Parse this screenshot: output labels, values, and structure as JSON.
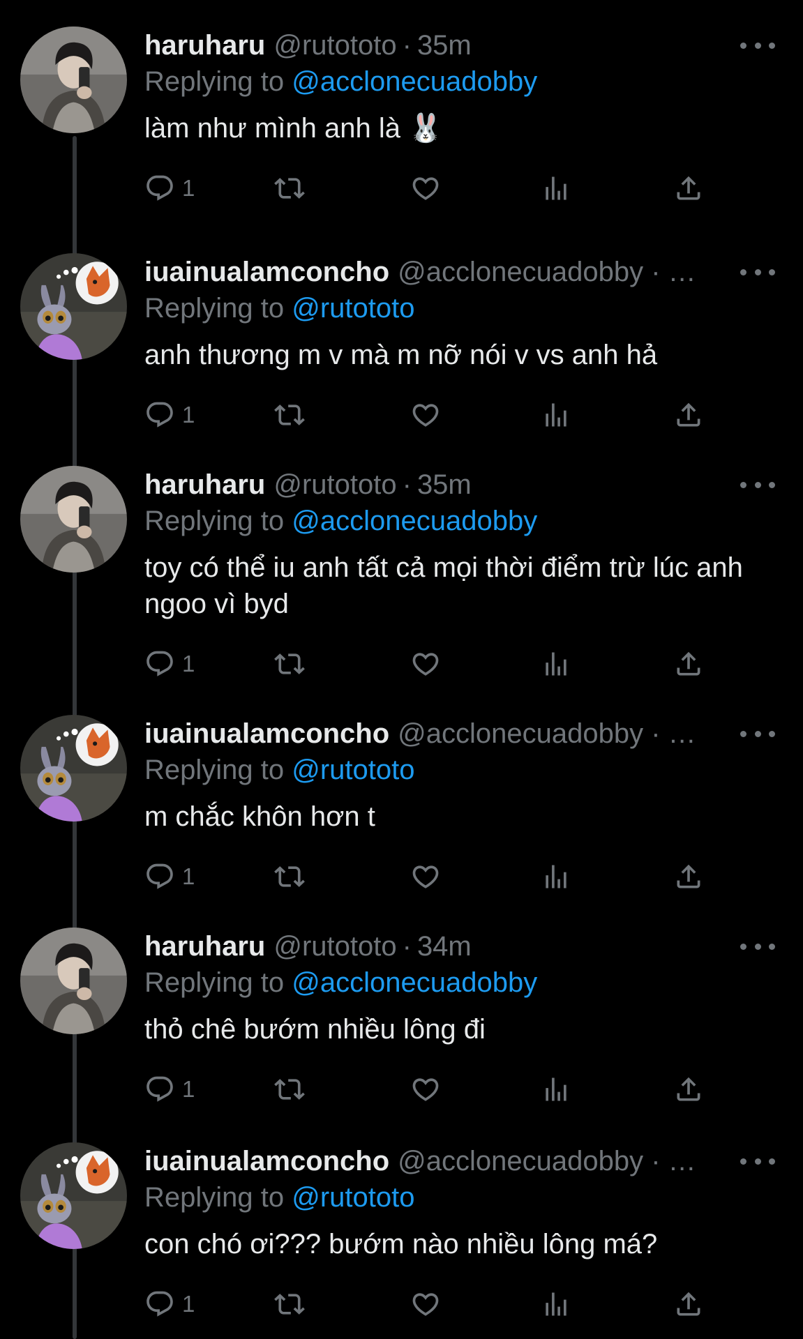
{
  "tweets": [
    {
      "avatar": "avatar-photo-selfie",
      "name": "haruharu",
      "handle": "@rutototo",
      "time": "35m",
      "reply_prefix": "Replying to",
      "reply_to": "@acclonecuadobby",
      "text": "làm như mình anh là 🐰",
      "reply_count": "1"
    },
    {
      "avatar": "avatar-cartoon-bunny-fox",
      "name": "iuainualamconcho",
      "handle": "@acclonecuadobby",
      "time": "",
      "reply_prefix": "Replying to",
      "reply_to": "@rutototo",
      "text": "anh thương m v mà m nỡ nói v vs anh hả",
      "reply_count": "1"
    },
    {
      "avatar": "avatar-photo-selfie",
      "name": "haruharu",
      "handle": "@rutototo",
      "time": "35m",
      "reply_prefix": "Replying to",
      "reply_to": "@acclonecuadobby",
      "text": "toy có thể iu anh tất cả mọi thời điểm trừ lúc anh ngoo vì byd",
      "reply_count": "1"
    },
    {
      "avatar": "avatar-cartoon-bunny-fox",
      "name": "iuainualamconcho",
      "handle": "@acclonecuadobby",
      "time": "",
      "reply_prefix": "Replying to",
      "reply_to": "@rutototo",
      "text": "m chắc khôn hơn t",
      "reply_count": "1"
    },
    {
      "avatar": "avatar-photo-selfie",
      "name": "haruharu",
      "handle": "@rutototo",
      "time": "34m",
      "reply_prefix": "Replying to",
      "reply_to": "@acclonecuadobby",
      "text": "thỏ chê bướm nhiều lông đi",
      "reply_count": "1"
    },
    {
      "avatar": "avatar-cartoon-bunny-fox",
      "name": "iuainualamconcho",
      "handle": "@acclonecuadobby",
      "time": "",
      "reply_prefix": "Replying to",
      "reply_to": "@rutototo",
      "text": "con chó ơi??? bướm nào nhiều lông má?",
      "reply_count": "1"
    }
  ],
  "truncation": "· …",
  "colors": {
    "background": "#000000",
    "text": "#e7e9ea",
    "muted": "#71767b",
    "link": "#1d9bf0",
    "thread_line": "#333639"
  },
  "icons": [
    "reply-icon",
    "retweet-icon",
    "like-icon",
    "views-icon",
    "share-icon",
    "more-icon"
  ]
}
